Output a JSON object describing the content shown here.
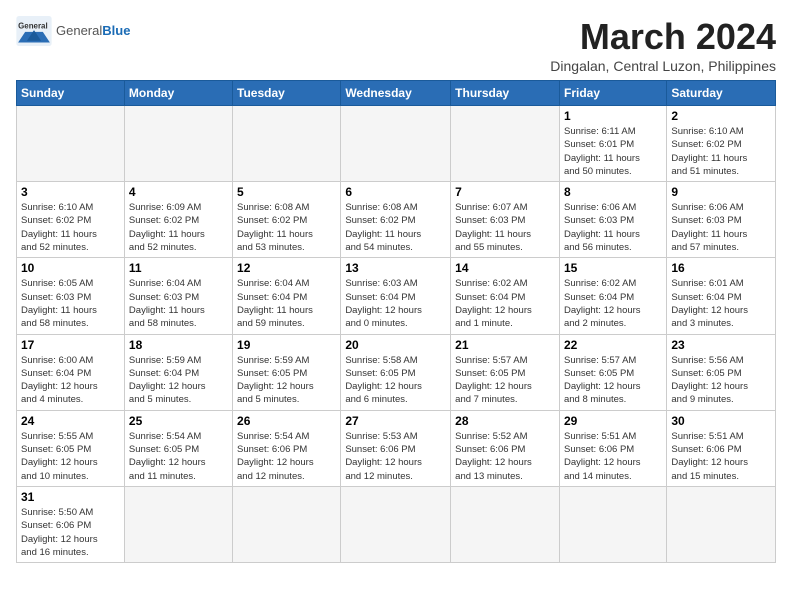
{
  "header": {
    "logo_general": "General",
    "logo_blue": "Blue",
    "month_title": "March 2024",
    "subtitle": "Dingalan, Central Luzon, Philippines"
  },
  "weekdays": [
    "Sunday",
    "Monday",
    "Tuesday",
    "Wednesday",
    "Thursday",
    "Friday",
    "Saturday"
  ],
  "weeks": [
    [
      {
        "day": "",
        "info": ""
      },
      {
        "day": "",
        "info": ""
      },
      {
        "day": "",
        "info": ""
      },
      {
        "day": "",
        "info": ""
      },
      {
        "day": "",
        "info": ""
      },
      {
        "day": "1",
        "info": "Sunrise: 6:11 AM\nSunset: 6:01 PM\nDaylight: 11 hours\nand 50 minutes."
      },
      {
        "day": "2",
        "info": "Sunrise: 6:10 AM\nSunset: 6:02 PM\nDaylight: 11 hours\nand 51 minutes."
      }
    ],
    [
      {
        "day": "3",
        "info": "Sunrise: 6:10 AM\nSunset: 6:02 PM\nDaylight: 11 hours\nand 52 minutes."
      },
      {
        "day": "4",
        "info": "Sunrise: 6:09 AM\nSunset: 6:02 PM\nDaylight: 11 hours\nand 52 minutes."
      },
      {
        "day": "5",
        "info": "Sunrise: 6:08 AM\nSunset: 6:02 PM\nDaylight: 11 hours\nand 53 minutes."
      },
      {
        "day": "6",
        "info": "Sunrise: 6:08 AM\nSunset: 6:02 PM\nDaylight: 11 hours\nand 54 minutes."
      },
      {
        "day": "7",
        "info": "Sunrise: 6:07 AM\nSunset: 6:03 PM\nDaylight: 11 hours\nand 55 minutes."
      },
      {
        "day": "8",
        "info": "Sunrise: 6:06 AM\nSunset: 6:03 PM\nDaylight: 11 hours\nand 56 minutes."
      },
      {
        "day": "9",
        "info": "Sunrise: 6:06 AM\nSunset: 6:03 PM\nDaylight: 11 hours\nand 57 minutes."
      }
    ],
    [
      {
        "day": "10",
        "info": "Sunrise: 6:05 AM\nSunset: 6:03 PM\nDaylight: 11 hours\nand 58 minutes."
      },
      {
        "day": "11",
        "info": "Sunrise: 6:04 AM\nSunset: 6:03 PM\nDaylight: 11 hours\nand 58 minutes."
      },
      {
        "day": "12",
        "info": "Sunrise: 6:04 AM\nSunset: 6:04 PM\nDaylight: 11 hours\nand 59 minutes."
      },
      {
        "day": "13",
        "info": "Sunrise: 6:03 AM\nSunset: 6:04 PM\nDaylight: 12 hours\nand 0 minutes."
      },
      {
        "day": "14",
        "info": "Sunrise: 6:02 AM\nSunset: 6:04 PM\nDaylight: 12 hours\nand 1 minute."
      },
      {
        "day": "15",
        "info": "Sunrise: 6:02 AM\nSunset: 6:04 PM\nDaylight: 12 hours\nand 2 minutes."
      },
      {
        "day": "16",
        "info": "Sunrise: 6:01 AM\nSunset: 6:04 PM\nDaylight: 12 hours\nand 3 minutes."
      }
    ],
    [
      {
        "day": "17",
        "info": "Sunrise: 6:00 AM\nSunset: 6:04 PM\nDaylight: 12 hours\nand 4 minutes."
      },
      {
        "day": "18",
        "info": "Sunrise: 5:59 AM\nSunset: 6:04 PM\nDaylight: 12 hours\nand 5 minutes."
      },
      {
        "day": "19",
        "info": "Sunrise: 5:59 AM\nSunset: 6:05 PM\nDaylight: 12 hours\nand 5 minutes."
      },
      {
        "day": "20",
        "info": "Sunrise: 5:58 AM\nSunset: 6:05 PM\nDaylight: 12 hours\nand 6 minutes."
      },
      {
        "day": "21",
        "info": "Sunrise: 5:57 AM\nSunset: 6:05 PM\nDaylight: 12 hours\nand 7 minutes."
      },
      {
        "day": "22",
        "info": "Sunrise: 5:57 AM\nSunset: 6:05 PM\nDaylight: 12 hours\nand 8 minutes."
      },
      {
        "day": "23",
        "info": "Sunrise: 5:56 AM\nSunset: 6:05 PM\nDaylight: 12 hours\nand 9 minutes."
      }
    ],
    [
      {
        "day": "24",
        "info": "Sunrise: 5:55 AM\nSunset: 6:05 PM\nDaylight: 12 hours\nand 10 minutes."
      },
      {
        "day": "25",
        "info": "Sunrise: 5:54 AM\nSunset: 6:05 PM\nDaylight: 12 hours\nand 11 minutes."
      },
      {
        "day": "26",
        "info": "Sunrise: 5:54 AM\nSunset: 6:06 PM\nDaylight: 12 hours\nand 12 minutes."
      },
      {
        "day": "27",
        "info": "Sunrise: 5:53 AM\nSunset: 6:06 PM\nDaylight: 12 hours\nand 12 minutes."
      },
      {
        "day": "28",
        "info": "Sunrise: 5:52 AM\nSunset: 6:06 PM\nDaylight: 12 hours\nand 13 minutes."
      },
      {
        "day": "29",
        "info": "Sunrise: 5:51 AM\nSunset: 6:06 PM\nDaylight: 12 hours\nand 14 minutes."
      },
      {
        "day": "30",
        "info": "Sunrise: 5:51 AM\nSunset: 6:06 PM\nDaylight: 12 hours\nand 15 minutes."
      }
    ],
    [
      {
        "day": "31",
        "info": "Sunrise: 5:50 AM\nSunset: 6:06 PM\nDaylight: 12 hours\nand 16 minutes."
      },
      {
        "day": "",
        "info": ""
      },
      {
        "day": "",
        "info": ""
      },
      {
        "day": "",
        "info": ""
      },
      {
        "day": "",
        "info": ""
      },
      {
        "day": "",
        "info": ""
      },
      {
        "day": "",
        "info": ""
      }
    ]
  ]
}
